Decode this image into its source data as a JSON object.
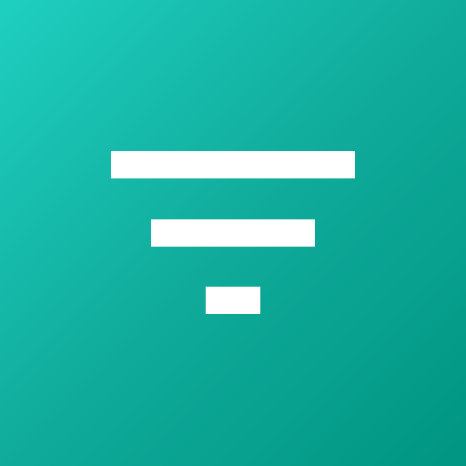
{
  "app_icon": {
    "icon": "filter-icon",
    "colors": {
      "background_gradient_start": "#1fcfc0",
      "background_gradient_mid": "#10ab9b",
      "background_gradient_end": "#009582",
      "glyph": "#ffffff"
    }
  }
}
